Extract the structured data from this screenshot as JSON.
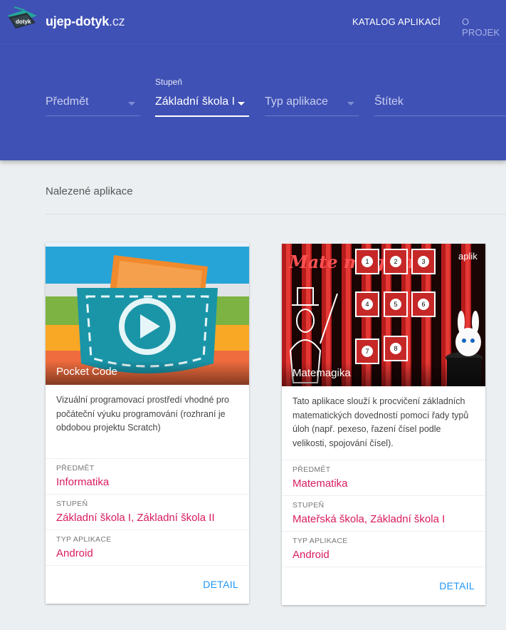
{
  "header": {
    "brand_main": "ujep-dotyk",
    "brand_tld": ".cz",
    "logo_text": "dotyk",
    "nav": [
      {
        "label": "KATALOG APLIKACÍ"
      },
      {
        "label": "O PROJEK"
      }
    ]
  },
  "filters": {
    "subject": {
      "value": "Předmět"
    },
    "level": {
      "label": "Stupeň",
      "value": "Základní škola I"
    },
    "app_type": {
      "value": "Typ aplikace"
    },
    "tag": {
      "value": "Štítek"
    }
  },
  "results": {
    "heading": "Nalezené aplikace",
    "detail_label": "DETAIL",
    "labels": {
      "subject": "PŘEDMĚT",
      "level": "STUPEŇ",
      "type": "TYP APLIKACE"
    },
    "cards": [
      {
        "title": "Pocket Code",
        "description": "Vizuální programovací prostředí vhodné pro počáteční výuku programování (rozhraní je obdobou projektu Scratch)",
        "subject": "Informatika",
        "level": "Základní škola I, Základní škola II",
        "type": "Android"
      },
      {
        "title": "Matemagika",
        "image_text": "Mate magika",
        "image_corner": "aplik",
        "tile_numbers": [
          "1",
          "2",
          "3",
          "4",
          "5",
          "6",
          "7",
          "8"
        ],
        "description": "Tato aplikace slouží k procvičení základních matematických dovedností pomocí řady typů úloh (např. pexeso, řazení čísel podle velikosti, spojování čísel).",
        "subject": "Matematika",
        "level": "Mateřská škola, Základní škola I",
        "type": "Android"
      }
    ]
  },
  "colors": {
    "primary": "#3f51b5",
    "accent": "#d81b60",
    "link": "#2196f3",
    "background": "#eceff1"
  }
}
